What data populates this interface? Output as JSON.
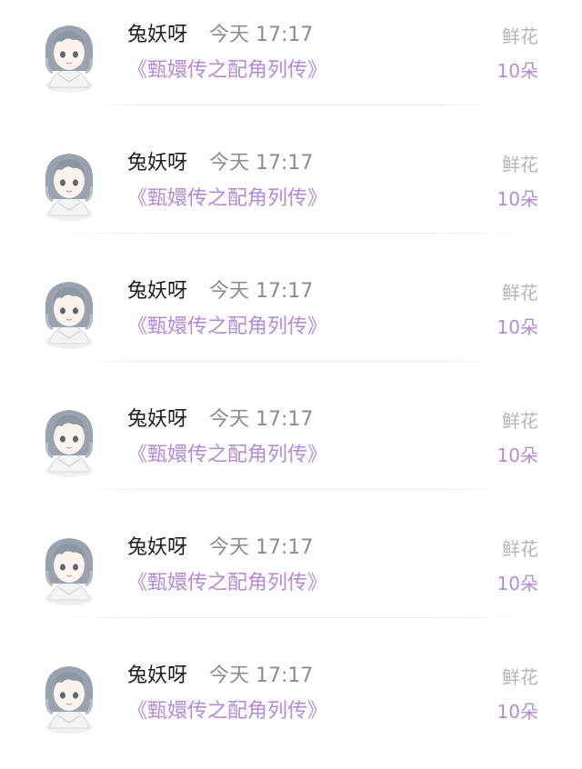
{
  "colors": {
    "accent": "#b58ad6",
    "name": "#1f1f1f",
    "time": "#8c8c8c",
    "gift_label": "#b5b5b5"
  },
  "items": [
    {
      "name": "兔妖呀",
      "time": "今天 17:17",
      "title": "《甄嬛传之配角列传》",
      "gift_label": "鲜花",
      "gift_count": "10朵",
      "avatar_icon": "anime-girl-avatar"
    },
    {
      "name": "兔妖呀",
      "time": "今天 17:17",
      "title": "《甄嬛传之配角列传》",
      "gift_label": "鲜花",
      "gift_count": "10朵",
      "avatar_icon": "anime-girl-avatar"
    },
    {
      "name": "兔妖呀",
      "time": "今天 17:17",
      "title": "《甄嬛传之配角列传》",
      "gift_label": "鲜花",
      "gift_count": "10朵",
      "avatar_icon": "anime-girl-avatar"
    },
    {
      "name": "兔妖呀",
      "time": "今天 17:17",
      "title": "《甄嬛传之配角列传》",
      "gift_label": "鲜花",
      "gift_count": "10朵",
      "avatar_icon": "anime-girl-avatar"
    },
    {
      "name": "兔妖呀",
      "time": "今天 17:17",
      "title": "《甄嬛传之配角列传》",
      "gift_label": "鲜花",
      "gift_count": "10朵",
      "avatar_icon": "anime-girl-avatar"
    },
    {
      "name": "兔妖呀",
      "time": "今天 17:17",
      "title": "《甄嬛传之配角列传》",
      "gift_label": "鲜花",
      "gift_count": "10朵",
      "avatar_icon": "anime-girl-avatar"
    }
  ]
}
